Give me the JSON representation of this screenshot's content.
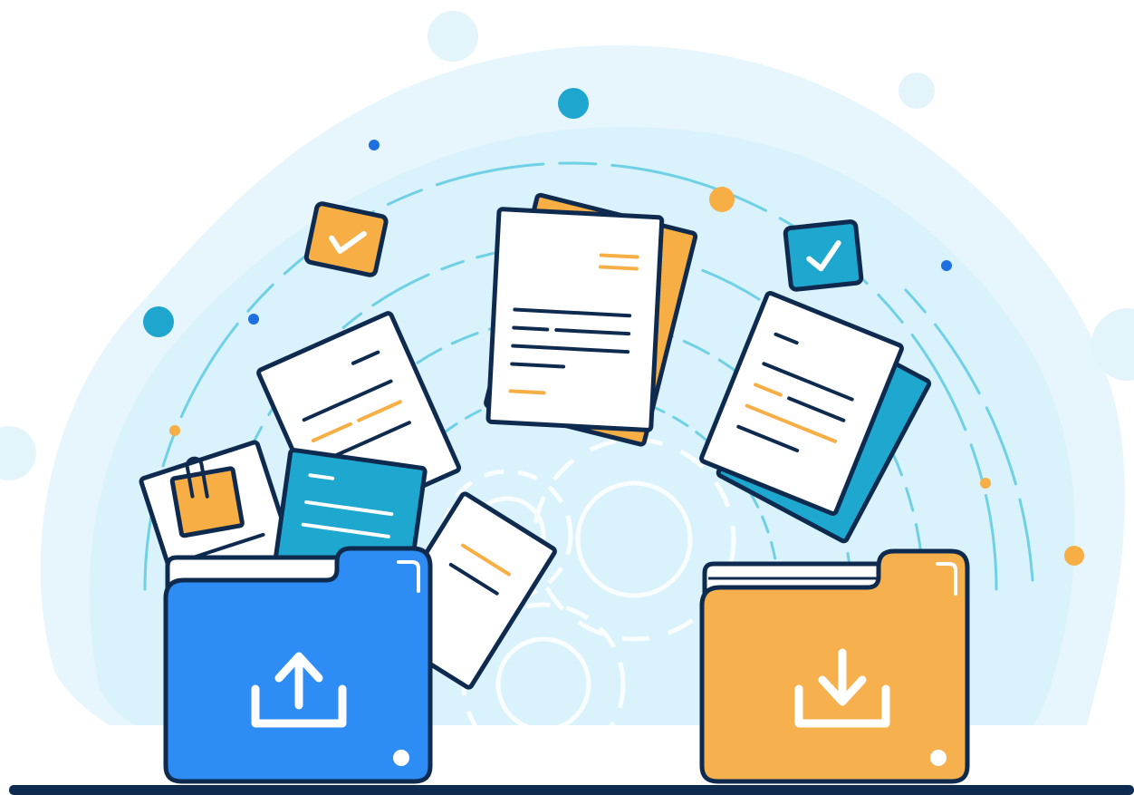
{
  "colors": {
    "background": "#ffffff",
    "blob_outer": "#e6f6fc",
    "blob_inner": "#d2eff9",
    "arc_line": "#6fd0e6",
    "outline": "#0f2a4f",
    "paper": "#ffffff",
    "orange": "#f6ae45",
    "teal": "#1ea7cf",
    "blue_folder": "#2d8df5",
    "orange_folder": "#f7b04e",
    "gear": "#ffffff",
    "dot_blue": "#1e6fe0",
    "dot_teal": "#1fa6cf",
    "dot_orange": "#f6ae45",
    "ground": "#0f2a4f"
  },
  "icons": {
    "left_folder": "upload-icon",
    "right_folder": "download-icon",
    "left_badge": "checkmark-icon",
    "right_badge": "checkmark-icon",
    "clip": "paperclip-icon",
    "gears": "gear-icon"
  }
}
